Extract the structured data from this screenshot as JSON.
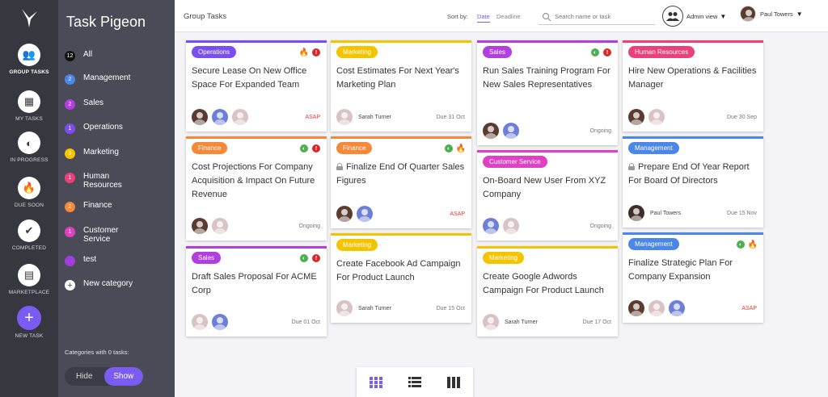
{
  "app": {
    "name": "Task Pigeon"
  },
  "rail": {
    "items": [
      {
        "label": "GROUP TASKS",
        "icon": "group-icon"
      },
      {
        "label": "MY TASKS",
        "icon": "grid-icon"
      },
      {
        "label": "IN PROGRESS",
        "icon": "progress-icon"
      },
      {
        "label": "DUE SOON",
        "icon": "fire-icon"
      },
      {
        "label": "COMPLETED",
        "icon": "check-icon"
      },
      {
        "label": "MARKETPLACE",
        "icon": "store-icon"
      }
    ],
    "new_task": {
      "label": "NEW TASK",
      "glyph": "+"
    }
  },
  "categories": {
    "items": [
      {
        "label": "All",
        "count": "12",
        "color": "#111111"
      },
      {
        "label": "Management",
        "count": "2",
        "color": "#4a87e8"
      },
      {
        "label": "Sales",
        "count": "2",
        "color": "#b13ee0"
      },
      {
        "label": "Operations",
        "count": "1",
        "color": "#7a4ef0"
      },
      {
        "label": "Marketing",
        "count": "3",
        "color": "#f5c400"
      },
      {
        "label": "Human Resources",
        "count": "1",
        "color": "#ec407a"
      },
      {
        "label": "Finance",
        "count": "2",
        "color": "#f5893a"
      },
      {
        "label": "Customer Service",
        "count": "1",
        "color": "#e040c4"
      },
      {
        "label": "test",
        "count": "",
        "color": "#a33de0"
      },
      {
        "label": "New category",
        "count": "+",
        "color": "#ffffff"
      }
    ],
    "zero_label": "Categories with 0 tasks:",
    "hide": "Hide",
    "show": "Show"
  },
  "topbar": {
    "title": "Group Tasks",
    "sort_label": "Sort by:",
    "sort_date": "Date",
    "sort_deadline": "Deadline",
    "search_placeholder": "Search name or task",
    "admin_label": "Admin view",
    "user_name": "Paul Towers"
  },
  "colors": {
    "Operations": "#7a4ef0",
    "Marketing": "#f5c400",
    "Sales": "#b13ee0",
    "Human Resources": "#ec407a",
    "Finance": "#f5893a",
    "Management": "#4a87e8",
    "Customer Service": "#e040c4",
    "accent": "#7b5cf2"
  },
  "cards": [
    {
      "category": "Operations",
      "title": "Secure Lease On New Office Space For Expanded Team",
      "icons": [
        "fire",
        "alert"
      ],
      "avatars": [
        "a",
        "b",
        "c"
      ],
      "person": "",
      "status": "ASAP",
      "locked": false
    },
    {
      "category": "Finance",
      "title": "Cost Projections For Company Acquisition & Impact On Future Revenue",
      "icons": [
        "progress",
        "alert"
      ],
      "avatars": [
        "a",
        "c"
      ],
      "person": "",
      "status": "Ongoing",
      "locked": false
    },
    {
      "category": "Sales",
      "title": "Draft Sales Proposal For ACME Corp",
      "icons": [
        "progress",
        "alert"
      ],
      "avatars": [
        "c",
        "b"
      ],
      "person": "",
      "status": "Due 01 Oct",
      "locked": false
    },
    {
      "category": "Marketing",
      "title": "Cost Estimates For Next Year's Marketing Plan",
      "icons": [],
      "avatars": [
        "c"
      ],
      "person": "Sarah Turner",
      "status": "Due 31 Oct",
      "locked": false
    },
    {
      "category": "Finance",
      "title": "Finalize End Of Quarter Sales Figures",
      "icons": [
        "progress",
        "fire"
      ],
      "avatars": [
        "a",
        "b"
      ],
      "person": "",
      "status": "ASAP",
      "locked": true
    },
    {
      "category": "Marketing",
      "title": "Create Facebook Ad Campaign For Product Launch",
      "icons": [],
      "avatars": [
        "c"
      ],
      "person": "Sarah Turner",
      "status": "Due 15 Oct",
      "locked": false
    },
    {
      "category": "Sales",
      "title": "Run Sales Training Program For New Sales Representatives",
      "icons": [
        "progress",
        "alert"
      ],
      "avatars": [
        "a",
        "b"
      ],
      "person": "",
      "status": "Ongoing",
      "locked": false
    },
    {
      "category": "Customer Service",
      "title": "On-Board New User From XYZ Company",
      "icons": [],
      "avatars": [
        "b",
        "c"
      ],
      "person": "",
      "status": "Ongoing",
      "locked": false
    },
    {
      "category": "Marketing",
      "title": "Create Google Adwords Campaign For Product Launch",
      "icons": [],
      "avatars": [
        "c"
      ],
      "person": "Sarah Turner",
      "status": "Due 17 Oct",
      "locked": false
    },
    {
      "category": "Human Resources",
      "title": "Hire New Operations & Facilities Manager",
      "icons": [],
      "avatars": [
        "a",
        "c"
      ],
      "person": "",
      "status": "Due 30 Sep",
      "locked": false
    },
    {
      "category": "Management",
      "title": "Prepare End Of Year Report For Board Of Directors",
      "icons": [],
      "avatars": [
        "d"
      ],
      "person": "Paul Towers",
      "status": "Due 15 Nov",
      "locked": true
    },
    {
      "category": "Management",
      "title": "Finalize Strategic Plan For Company Expansion",
      "icons": [
        "progress",
        "fire"
      ],
      "avatars": [
        "a",
        "c",
        "b"
      ],
      "person": "",
      "status": "ASAP",
      "locked": false
    }
  ],
  "views": [
    {
      "name": "grid-view",
      "color": "#7b5cf2"
    },
    {
      "name": "list-view",
      "color": "#333333"
    },
    {
      "name": "columns-view",
      "color": "#333333"
    }
  ]
}
